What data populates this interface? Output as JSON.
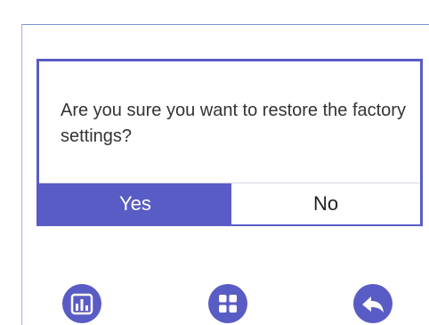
{
  "dialog": {
    "message": "Are you sure you want to restore the factory settings?",
    "yes_label": "Yes",
    "no_label": "No"
  },
  "bottom_bar": {
    "icons": [
      "bar-chart-icon",
      "grid-icon",
      "back-arrow-icon"
    ]
  },
  "colors": {
    "accent": "#5a5cc5",
    "frame": "#7f95d8",
    "text": "#333333",
    "background": "#ffffff"
  }
}
